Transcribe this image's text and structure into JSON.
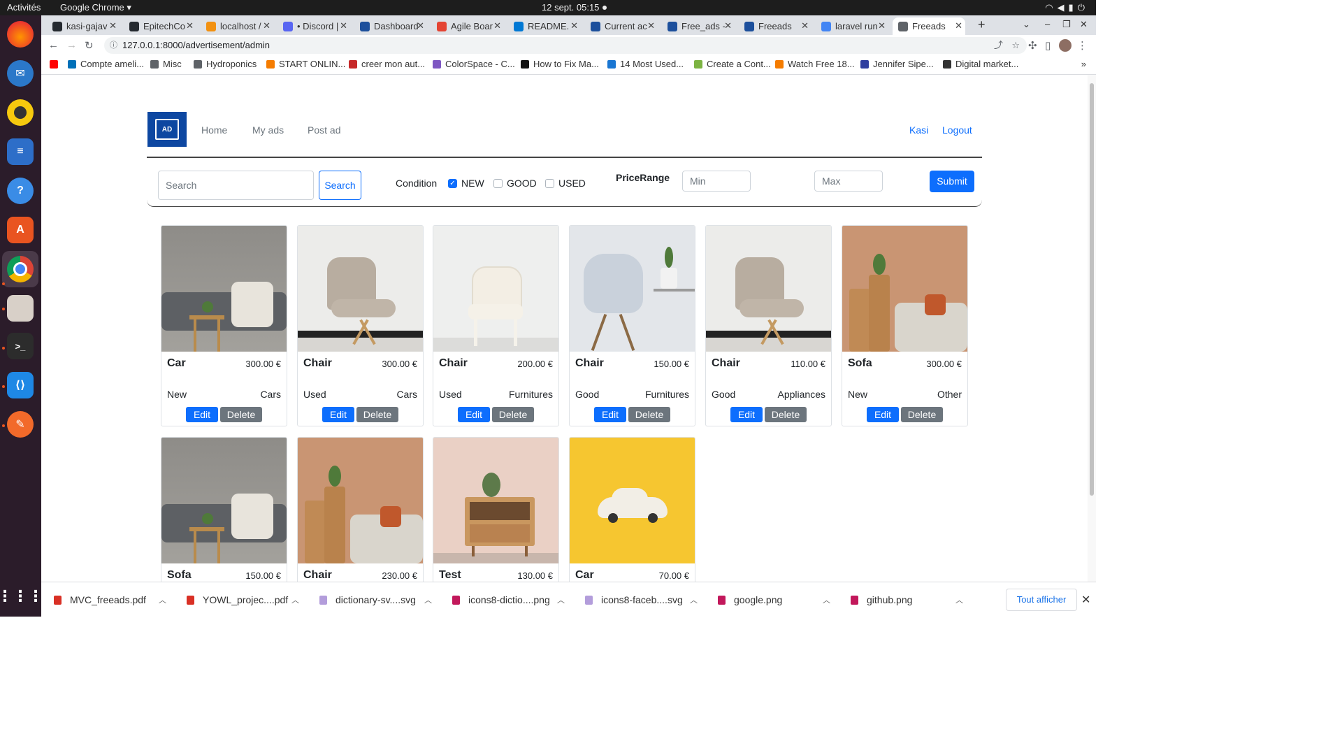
{
  "system": {
    "activities": "Activités",
    "app": "Google Chrome ▾",
    "clock": "12 sept.  05:15"
  },
  "tabs": [
    {
      "label": "kasi-gajav",
      "color": "#24292f"
    },
    {
      "label": "EpitechCo",
      "color": "#24292f"
    },
    {
      "label": "localhost /",
      "color": "#f29111"
    },
    {
      "label": "• Discord |",
      "color": "#5865f2"
    },
    {
      "label": "Dashboard",
      "color": "#1c4f9c"
    },
    {
      "label": "Agile Boar",
      "color": "#e44332"
    },
    {
      "label": "README.",
      "color": "#0078d4"
    },
    {
      "label": "Current ac",
      "color": "#1c4f9c"
    },
    {
      "label": "Free_ads -",
      "color": "#1c4f9c"
    },
    {
      "label": "Freeads",
      "color": "#1c4f9c"
    },
    {
      "label": "laravel run",
      "color": "#4285f4"
    },
    {
      "label": "Freeads",
      "color": "#5f6368"
    }
  ],
  "url": "127.0.0.1:8000/advertisement/admin",
  "bookmarks": [
    {
      "label": "",
      "color": "#ff0000"
    },
    {
      "label": "Compte ameli...",
      "color": "#0070b8"
    },
    {
      "label": "Misc",
      "color": "#5f6368"
    },
    {
      "label": "Hydroponics",
      "color": "#5f6368"
    },
    {
      "label": "START ONLIN...",
      "color": "#f57c00"
    },
    {
      "label": "creer mon aut...",
      "color": "#c62828"
    },
    {
      "label": "ColorSpace - C...",
      "color": "#7e57c2"
    },
    {
      "label": "How to Fix Ma...",
      "color": "#111111"
    },
    {
      "label": "14 Most Used...",
      "color": "#1976d2"
    },
    {
      "label": "Create a Cont...",
      "color": "#7cb342"
    },
    {
      "label": "Watch Free 18...",
      "color": "#f57c00"
    },
    {
      "label": "Jennifer Sipe...",
      "color": "#303f9f"
    },
    {
      "label": "Digital market...",
      "color": "#333333"
    }
  ],
  "nav": {
    "links": [
      "Home",
      "My ads",
      "Post ad"
    ],
    "user": "Kasi",
    "logout": "Logout"
  },
  "filter": {
    "search_placeholder": "Search",
    "search_button": "Search",
    "condition_label": "Condition",
    "conditions": [
      {
        "label": "NEW",
        "checked": true
      },
      {
        "label": "GOOD",
        "checked": false
      },
      {
        "label": "USED",
        "checked": false
      }
    ],
    "price_label": "PriceRange",
    "min_placeholder": "Min",
    "max_placeholder": "Max",
    "submit": "Submit"
  },
  "card_actions": {
    "edit": "Edit",
    "delete": "Delete"
  },
  "ads": [
    {
      "name": "Car",
      "price": "300.00 €",
      "condition": "New",
      "category": "Cars",
      "image": "sofa"
    },
    {
      "name": "Chair",
      "price": "300.00 €",
      "condition": "Used",
      "category": "Cars",
      "image": "chair-beige"
    },
    {
      "name": "Chair",
      "price": "200.00 €",
      "condition": "Used",
      "category": "Furnitures",
      "image": "chair-white"
    },
    {
      "name": "Chair",
      "price": "150.00 €",
      "condition": "Good",
      "category": "Furnitures",
      "image": "chair-plastic"
    },
    {
      "name": "Chair",
      "price": "110.00 €",
      "condition": "Good",
      "category": "Appliances",
      "image": "chair-beige"
    },
    {
      "name": "Sofa",
      "price": "300.00 €",
      "condition": "New",
      "category": "Other",
      "image": "sofa-terracotta"
    },
    {
      "name": "Sofa",
      "price": "150.00 €",
      "condition": "",
      "category": "",
      "image": "sofa"
    },
    {
      "name": "Chair",
      "price": "230.00 €",
      "condition": "",
      "category": "",
      "image": "sofa-terracotta"
    },
    {
      "name": "Test",
      "price": "130.00 €",
      "condition": "",
      "category": "",
      "image": "nightstand"
    },
    {
      "name": "Car",
      "price": "70.00 €",
      "condition": "",
      "category": "",
      "image": "toy-car"
    }
  ],
  "downloads": [
    {
      "label": "MVC_freeads.pdf",
      "color": "#d93025"
    },
    {
      "label": "YOWL_projec....pdf",
      "color": "#d93025"
    },
    {
      "label": "dictionary-sv....svg",
      "color": "#b39ddb"
    },
    {
      "label": "icons8-dictio....png",
      "color": "#c2185b"
    },
    {
      "label": "icons8-faceb....svg",
      "color": "#b39ddb"
    },
    {
      "label": "google.png",
      "color": "#c2185b"
    },
    {
      "label": "github.png",
      "color": "#c2185b"
    }
  ],
  "show_all": "Tout afficher"
}
